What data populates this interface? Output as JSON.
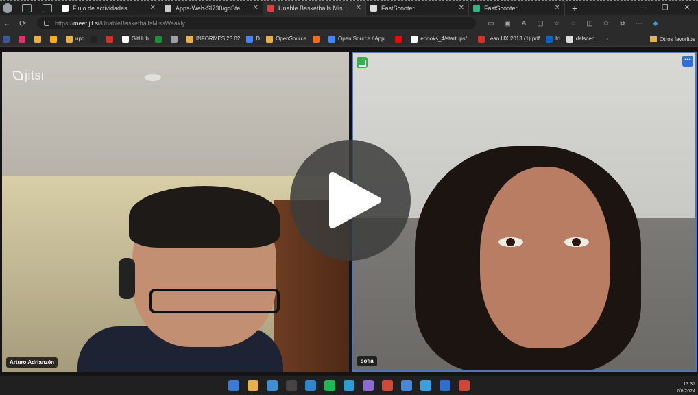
{
  "browser": {
    "tabs": [
      {
        "label": "Flujo de actividades",
        "color": "#ffffff"
      },
      {
        "label": "Apps-Web-SI730/goSteel-Landi",
        "color": "#c9c9c9"
      },
      {
        "label": "Unable Basketballs Miss W",
        "color": "#e33d3d"
      },
      {
        "label": "FastScooter",
        "color": "#dcdcdc"
      },
      {
        "label": "FastScooter",
        "color": "#36b37e"
      }
    ],
    "new_tab_label": "+",
    "url_prefix": "https://",
    "url_host": "meet.jit.si",
    "url_path": "/UnableBasketballsMissWeakly",
    "bookmarks": [
      {
        "label": "",
        "color": "#3b5998"
      },
      {
        "label": "",
        "color": "#e1306c"
      },
      {
        "label": "",
        "color": "#e8b04a"
      },
      {
        "label": "",
        "color": "#ffb000"
      },
      {
        "label": "upc",
        "color": "#e8b04a"
      },
      {
        "label": "",
        "color": "#222222"
      },
      {
        "label": "",
        "color": "#d93025"
      },
      {
        "label": "GitHub",
        "color": "#ffffff"
      },
      {
        "label": "",
        "color": "#1e8e3e"
      },
      {
        "label": "",
        "color": "#9aa0a6"
      },
      {
        "label": "INFORMES 23.02",
        "color": "#e8b04a"
      },
      {
        "label": "D",
        "color": "#4285f4"
      },
      {
        "label": "OpenSource",
        "color": "#e8b04a"
      },
      {
        "label": "",
        "color": "#f26b21"
      },
      {
        "label": "Open Source / App...",
        "color": "#4285f4"
      },
      {
        "label": "",
        "color": "#ff0000"
      },
      {
        "label": "ebooks_4/startups/...",
        "color": "#ffffff"
      },
      {
        "label": "Lean UX 2013 (1).pdf",
        "color": "#d93025"
      },
      {
        "label": "Id",
        "color": "#0a66c2"
      },
      {
        "label": "delscen",
        "color": "#dddddd"
      }
    ],
    "bookmarks_more": "Otros favoritos"
  },
  "meeting": {
    "brand": "jitsi",
    "participants": [
      {
        "name": "Arturo Adrianzén"
      },
      {
        "name": "sofia"
      }
    ],
    "more_label": "•••"
  },
  "taskbar": {
    "time": "13:37",
    "date": "7/6/2024",
    "icons": [
      "#3a7bd5",
      "#e8b04a",
      "#3d8fd6",
      "#444444",
      "#2a87d0",
      "#1db954",
      "#2a9fd6",
      "#8a6bd6",
      "#d04a3a",
      "#4a88d6",
      "#3aa0e0",
      "#2d6fd0",
      "#d0463a"
    ]
  }
}
